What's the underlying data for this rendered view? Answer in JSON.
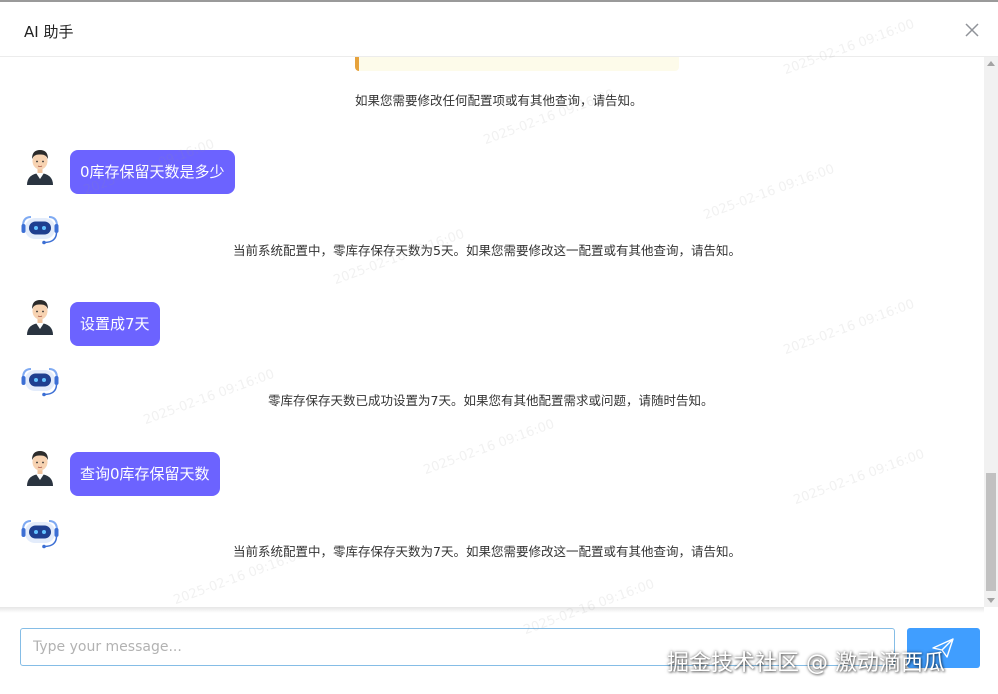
{
  "header": {
    "title": "AI 助手",
    "close_icon": "close-icon"
  },
  "messages": [
    {
      "role": "ai",
      "text": "如果您需要修改任何配置项或有其他查询，请告知。"
    },
    {
      "role": "user",
      "text": "0库存保留天数是多少"
    },
    {
      "role": "ai",
      "text": "当前系统配置中，零库存保存天数为5天。如果您需要修改这一配置或有其他查询，请告知。"
    },
    {
      "role": "user",
      "text": "设置成7天"
    },
    {
      "role": "ai",
      "text": "零库存保存天数已成功设置为7天。如果您有其他配置需求或问题，请随时告知。"
    },
    {
      "role": "user",
      "text": "查询0库存保留天数"
    },
    {
      "role": "ai",
      "text": "当前系统配置中，零库存保存天数为7天。如果您需要修改这一配置或有其他查询，请告知。"
    }
  ],
  "input": {
    "value": "",
    "placeholder": "Type your message..."
  },
  "send_button": {
    "icon": "send-icon"
  },
  "watermark_text": "2025-02-16 09:16:00",
  "brand_overlay": "掘金技术社区 @ 激动滴西瓜",
  "colors": {
    "user_bubble": "#6c63ff",
    "send_button": "#409eff",
    "input_border": "#85bde6",
    "highlight_border": "#e6a23c"
  }
}
